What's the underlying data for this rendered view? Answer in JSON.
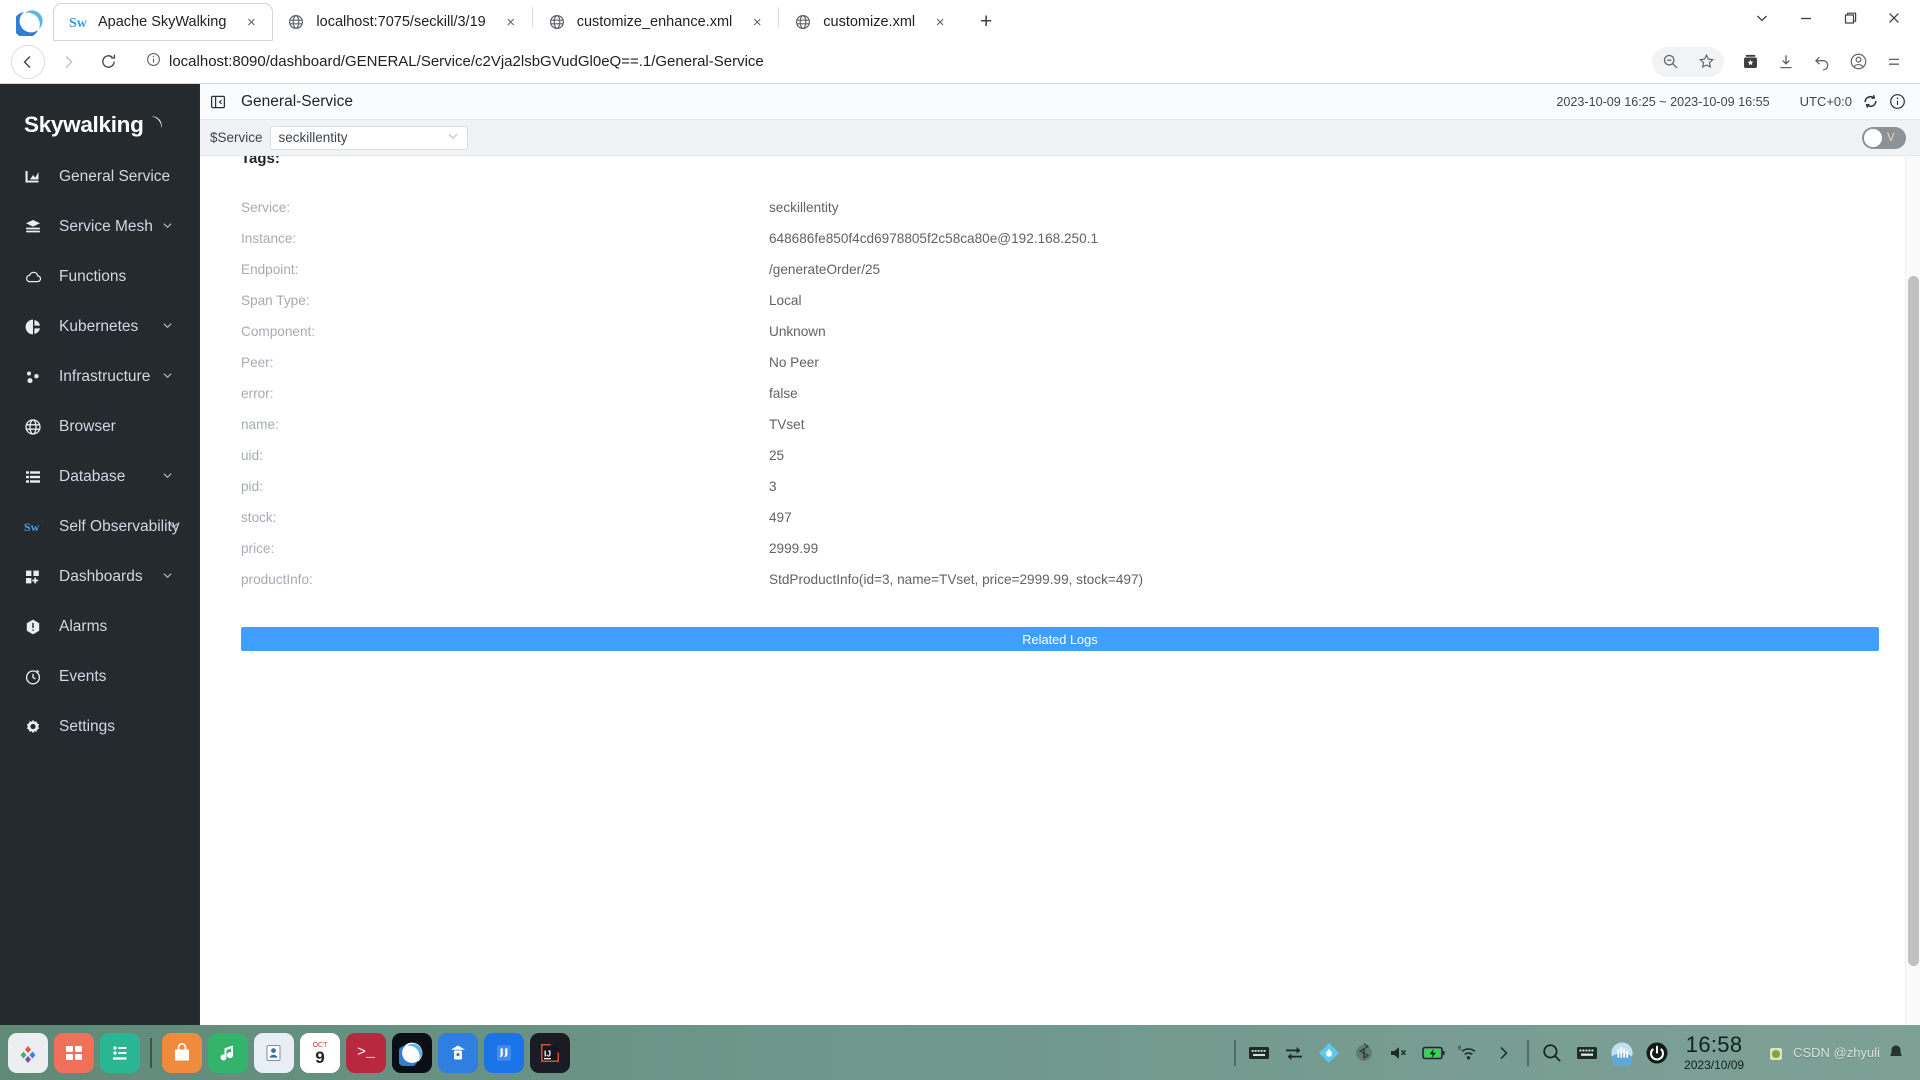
{
  "browser": {
    "tabs": [
      {
        "title": "Apache SkyWalking",
        "favicon": "skywalking-favicon",
        "active": true,
        "closable": true
      },
      {
        "title": "localhost:7075/seckill/3/19",
        "favicon": "globe-favicon",
        "active": false,
        "closable": true
      },
      {
        "title": "customize_enhance.xml",
        "favicon": "globe-favicon",
        "active": false,
        "closable": true
      },
      {
        "title": "customize.xml",
        "favicon": "globe-favicon",
        "active": false,
        "closable": true
      }
    ],
    "new_tab_label": "+",
    "close_label": "×",
    "url": "localhost:8090/dashboard/GENERAL/Service/c2Vja2lsbGVudGl0eQ==.1/General-Service",
    "window_controls": {
      "more": "⌄",
      "minimize": "—",
      "maximize": "❐",
      "close": "✕"
    }
  },
  "sidebar": {
    "logo_text": "Skywalking",
    "items": [
      {
        "label": "General Service",
        "icon": "bar-chart-icon",
        "expandable": false
      },
      {
        "label": "Service Mesh",
        "icon": "layers-icon",
        "expandable": true
      },
      {
        "label": "Functions",
        "icon": "cloud-icon",
        "expandable": false
      },
      {
        "label": "Kubernetes",
        "icon": "pie-chart-icon",
        "expandable": true
      },
      {
        "label": "Infrastructure",
        "icon": "nodes-icon",
        "expandable": true
      },
      {
        "label": "Browser",
        "icon": "globe-icon",
        "expandable": false
      },
      {
        "label": "Database",
        "icon": "database-icon",
        "expandable": true
      },
      {
        "label": "Self Observability",
        "icon": "skywalking-icon",
        "expandable": true
      },
      {
        "label": "Dashboards",
        "icon": "grid-plus-icon",
        "expandable": true
      },
      {
        "label": "Alarms",
        "icon": "alert-icon",
        "expandable": false
      },
      {
        "label": "Events",
        "icon": "clock-icon",
        "expandable": false
      },
      {
        "label": "Settings",
        "icon": "gear-icon",
        "expandable": false
      }
    ]
  },
  "header": {
    "title": "General-Service",
    "time_range": "2023-10-09 16:25 ~ 2023-10-09 16:55",
    "utc": "UTC+0:0",
    "reload_icon": "refresh-icon",
    "info_icon": "info-icon",
    "collapse_icon": "collapse-panel-icon"
  },
  "filter_bar": {
    "label": "$Service",
    "selected_service": "seckillentity",
    "caret_icon": "chevron-down-icon",
    "toggle_label": "V",
    "toggle_on": false
  },
  "content": {
    "section_title": "Tags:",
    "rows": [
      {
        "key": "Service:",
        "value": "seckillentity"
      },
      {
        "key": "Instance:",
        "value": "648686fe850f4cd6978805f2c58ca80e@192.168.250.1"
      },
      {
        "key": "Endpoint:",
        "value": "/generateOrder/25"
      },
      {
        "key": "Span Type:",
        "value": "Local"
      },
      {
        "key": "Component:",
        "value": "Unknown"
      },
      {
        "key": "Peer:",
        "value": "No Peer"
      },
      {
        "key": "error:",
        "value": "false"
      },
      {
        "key": "name:",
        "value": "TVset"
      },
      {
        "key": "uid:",
        "value": "25"
      },
      {
        "key": "pid:",
        "value": "3"
      },
      {
        "key": "stock:",
        "value": "497"
      },
      {
        "key": "price:",
        "value": "2999.99"
      },
      {
        "key": "productInfo:",
        "value": "StdProductInfo(id=3, name=TVset, price=2999.99, stock=497)"
      }
    ],
    "related_logs_label": "Related Logs"
  },
  "taskbar": {
    "apps": [
      {
        "name": "app-launcher",
        "glyph": "❖",
        "bg": "#eceff1",
        "fg": "#5a6b88"
      },
      {
        "name": "app-dashboard",
        "glyph": "■",
        "bg": "#f0705a",
        "fg": "#ffffff"
      },
      {
        "name": "app-files",
        "glyph": "≡",
        "bg": "#2bb693",
        "fg": "#ffffff"
      },
      {
        "name": "app-store",
        "glyph": "□",
        "bg": "#f08a3c",
        "fg": "#ffffff"
      },
      {
        "name": "app-music",
        "glyph": "♫",
        "bg": "#34b36a",
        "fg": "#ffffff"
      },
      {
        "name": "app-contacts",
        "glyph": "☺",
        "bg": "#e9eef5",
        "fg": "#3b6ea8"
      },
      {
        "name": "app-calendar",
        "glyph": "9",
        "bg": "#ffffff",
        "fg": "#c63b2f"
      },
      {
        "name": "app-terminal",
        "glyph": ">_",
        "bg": "#b8283f",
        "fg": "#ffffff"
      },
      {
        "name": "app-browser",
        "glyph": "◐",
        "bg": "#0b0e14",
        "fg": "#2f9bd8"
      },
      {
        "name": "app-mail",
        "glyph": "▲",
        "bg": "#2f7fe0",
        "fg": "#ffffff"
      },
      {
        "name": "app-notes",
        "glyph": "“",
        "bg": "#1a73e8",
        "fg": "#ffffff"
      },
      {
        "name": "app-intellij",
        "glyph": "IJ",
        "bg": "#1b1b24",
        "fg": "#ffffff"
      }
    ],
    "tray": [
      {
        "name": "keyboard-layout-icon",
        "glyph": "⌨"
      },
      {
        "name": "network-transfer-icon",
        "glyph": "⇄"
      },
      {
        "name": "clipboard-tool-icon",
        "glyph": "◆"
      },
      {
        "name": "bluetooth-icon",
        "glyph": "ᛦ"
      },
      {
        "name": "volume-muted-icon",
        "glyph": "🔇"
      },
      {
        "name": "battery-charging-icon",
        "glyph": "■"
      },
      {
        "name": "wifi-icon",
        "glyph": "◠"
      },
      {
        "name": "tray-expand-icon",
        "glyph": "›"
      },
      {
        "name": "search-icon",
        "glyph": "⚲"
      },
      {
        "name": "onscreen-keyboard-icon",
        "glyph": "⌨"
      },
      {
        "name": "sound-visualizer-icon",
        "glyph": "▂"
      },
      {
        "name": "power-icon",
        "glyph": "⏻"
      }
    ],
    "clock_time": "16:58",
    "clock_date": "2023/10/09",
    "watermark": "CSDN @zhyuli"
  }
}
